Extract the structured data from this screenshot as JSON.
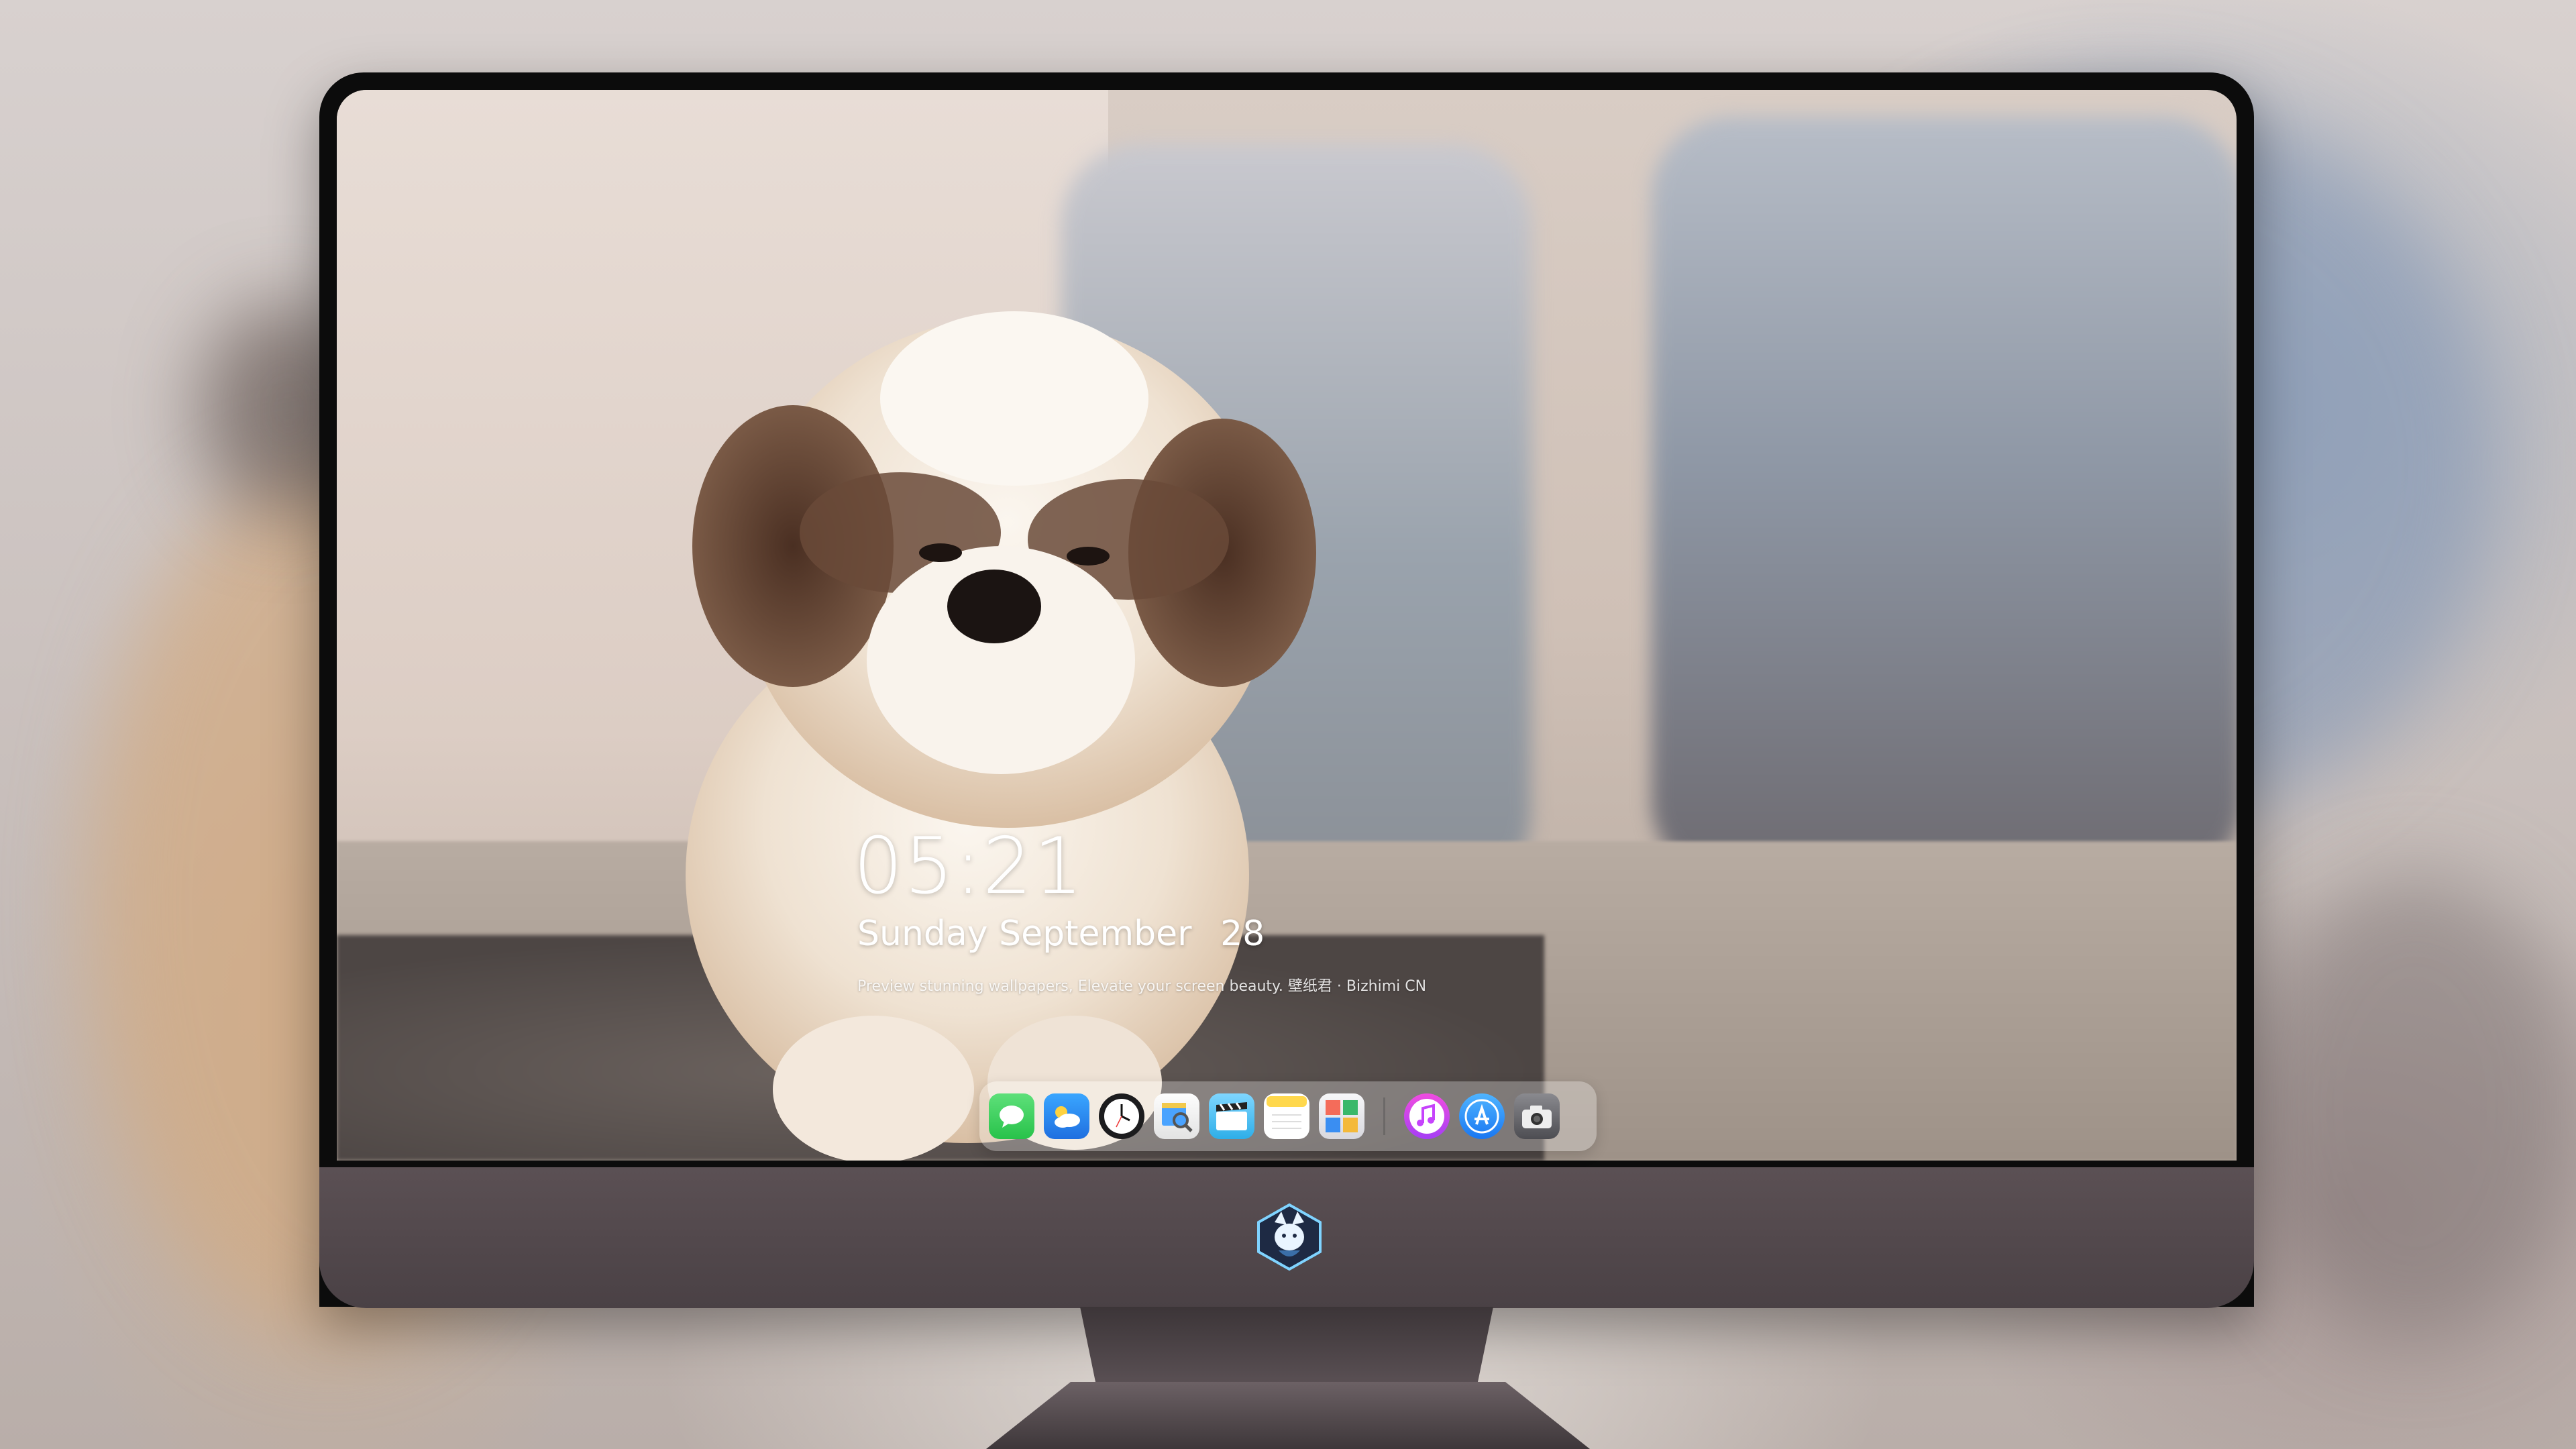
{
  "lockscreen": {
    "time": "05:21",
    "weekday": "Sunday",
    "month": "September",
    "day": "28",
    "tagline": "Preview stunning wallpapers, Elevate your screen beauty. 壁纸君 · Bizhimi CN"
  },
  "dock": {
    "apps": [
      {
        "name": "messages",
        "icon": "speech-bubble-icon",
        "color": "#34c759"
      },
      {
        "name": "weather",
        "icon": "cloud-sun-icon",
        "color": "#2f8cf5"
      },
      {
        "name": "clock",
        "icon": "clock-icon",
        "color": "#1c1c1e"
      },
      {
        "name": "preview",
        "icon": "photo-magnifier-icon",
        "color": "#f2c94c"
      },
      {
        "name": "clips",
        "icon": "clapperboard-icon",
        "color": "#5ac8fa"
      },
      {
        "name": "notes",
        "icon": "notepad-icon",
        "color": "#ffd84d"
      },
      {
        "name": "photo-booth",
        "icon": "image-grid-icon",
        "color": "#e9e9ee"
      },
      {
        "name": "music",
        "icon": "music-note-icon",
        "color": "#c643fc"
      },
      {
        "name": "app-store",
        "icon": "app-store-icon",
        "color": "#1e8ef7"
      },
      {
        "name": "camera",
        "icon": "camera-icon",
        "color": "#6b6b6f"
      }
    ]
  },
  "monitor": {
    "logo": "fox-emblem-icon",
    "chin_color": "#4f4549"
  }
}
